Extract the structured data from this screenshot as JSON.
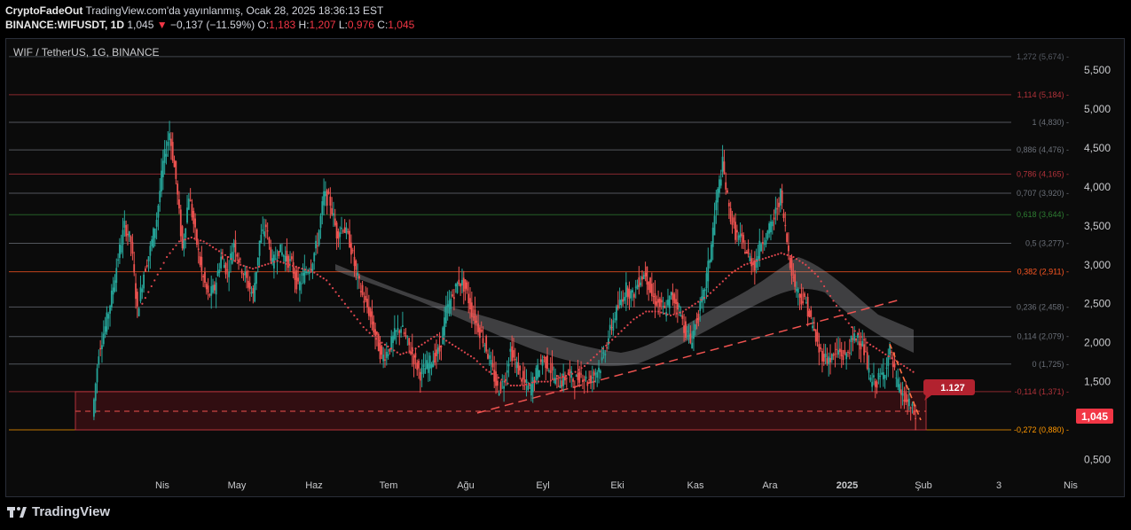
{
  "header": {
    "publisher_name": "CryptoFadeOut",
    "publisher_text": "TradingView.com'da yayınlanmış, Ocak 28, 2025 18:36:13 EST",
    "symbol": "BINANCE:WIFUSDT, 1D",
    "last": "1,045",
    "change": "−0,137 (−11.59%)",
    "o_label": "O:",
    "o_value": "1,183",
    "h_label": "H:",
    "h_value": "1,207",
    "l_label": "L:",
    "l_value": "0,976",
    "c_label": "C:",
    "c_value": "1,045"
  },
  "legend": {
    "title": "WIF / TetherUS, 1G, BINANCE"
  },
  "footer": {
    "brand": "TradingView"
  },
  "colors": {
    "up": "#26a69a",
    "down": "#ef5350",
    "background": "#0b0b0b",
    "fib_red": "#b2323a",
    "fib_green": "#2e7d32",
    "fib_orange": "#ff9800",
    "price_tag": "#f23645"
  },
  "chart_data": {
    "type": "candlestick",
    "y_axis_labels": [
      "5,500",
      "5,000",
      "4,500",
      "4,000",
      "3,500",
      "3,000",
      "2,500",
      "2,000",
      "1,500",
      "0,500"
    ],
    "ylim": [
      0.3,
      5.9
    ],
    "x_axis_labels": [
      "Nis",
      "May",
      "Haz",
      "Tem",
      "Ağu",
      "Eyl",
      "Eki",
      "Kas",
      "Ara",
      "2025",
      "Şub",
      "3",
      "Nis"
    ],
    "fib_levels": [
      {
        "label": "1,272 (5,674)",
        "value": 5.674,
        "color": "#555a63"
      },
      {
        "label": "1,114 (5,184)",
        "value": 5.184,
        "color": "#b2323a"
      },
      {
        "label": "1 (4,830)",
        "value": 4.83,
        "color": "#6b7079"
      },
      {
        "label": "0,886 (4,476)",
        "value": 4.476,
        "color": "#6b7079"
      },
      {
        "label": "0,786 (4,165)",
        "value": 4.165,
        "color": "#b2323a"
      },
      {
        "label": "0,707 (3,920)",
        "value": 3.92,
        "color": "#6b7079"
      },
      {
        "label": "0,618 (3,644)",
        "value": 3.644,
        "color": "#2e7d32"
      },
      {
        "label": "0,5 (3,277)",
        "value": 3.277,
        "color": "#6b7079"
      },
      {
        "label": "0,382 (2,911)",
        "value": 2.911,
        "color": "#ff5722"
      },
      {
        "label": "0,236 (2,458)",
        "value": 2.458,
        "color": "#6b7079"
      },
      {
        "label": "0,114 (2,079)",
        "value": 2.079,
        "color": "#6b7079"
      },
      {
        "label": "0 (1,725)",
        "value": 1.725,
        "color": "#6b7079"
      },
      {
        "label": "-0,114 (1,371)",
        "value": 1.371,
        "color": "#b2323a"
      },
      {
        "label": "-0,272 (0,880)",
        "value": 0.88,
        "color": "#ff9800"
      }
    ],
    "price_path": [
      1.05,
      1.9,
      2.2,
      2.6,
      3.1,
      3.5,
      3.3,
      2.4,
      2.9,
      3.2,
      3.6,
      4.3,
      4.7,
      4.1,
      3.2,
      3.9,
      3.4,
      2.9,
      2.6,
      2.7,
      3.1,
      2.9,
      3.3,
      3.0,
      2.8,
      2.6,
      3.3,
      3.5,
      3.0,
      3.2,
      3.1,
      3.0,
      2.7,
      2.9,
      3.0,
      3.3,
      3.9,
      3.8,
      3.4,
      3.5,
      3.3,
      2.9,
      2.6,
      2.4,
      2.1,
      1.8,
      1.9,
      2.1,
      2.2,
      2.0,
      1.8,
      1.6,
      1.7,
      1.8,
      1.9,
      2.4,
      2.6,
      2.8,
      2.7,
      2.4,
      2.2,
      2.0,
      1.7,
      1.4,
      1.5,
      1.9,
      1.7,
      1.5,
      1.4,
      1.6,
      1.8,
      1.7,
      1.5,
      1.5,
      1.6,
      1.5,
      1.6,
      1.5,
      1.6,
      1.7,
      2.0,
      2.3,
      2.5,
      2.7,
      2.6,
      2.8,
      2.9,
      2.6,
      2.5,
      2.4,
      2.6,
      2.5,
      2.2,
      2.0,
      2.3,
      2.6,
      3.1,
      3.8,
      4.3,
      3.7,
      3.4,
      3.3,
      3.1,
      3.0,
      3.3,
      3.4,
      3.6,
      3.9,
      3.3,
      2.8,
      2.6,
      2.5,
      2.2,
      1.9,
      1.8,
      1.8,
      1.9,
      1.8,
      2.0,
      2.1,
      1.9,
      1.5,
      1.5,
      1.6,
      1.9,
      1.5,
      1.3,
      1.2,
      1.05
    ],
    "sma_path": [
      null,
      null,
      null,
      null,
      2.5,
      2.8,
      3.1,
      3.3,
      3.35,
      3.3,
      3.2,
      3.1,
      3.0,
      2.95,
      3.0,
      3.05,
      3.0,
      2.95,
      2.9,
      2.8,
      2.6,
      2.4,
      2.2,
      2.05,
      1.95,
      1.85,
      1.9,
      2.0,
      2.1,
      2.0,
      1.9,
      1.8,
      1.65,
      1.55,
      1.45,
      1.45,
      1.5,
      1.5,
      1.55,
      1.6,
      1.7,
      1.85,
      2.0,
      2.15,
      2.3,
      2.4,
      2.4,
      2.35,
      2.4,
      2.5,
      2.6,
      2.75,
      2.9,
      3.0,
      3.05,
      3.1,
      3.15,
      3.1,
      3.0,
      2.85,
      2.6,
      2.35,
      2.15,
      2.0,
      1.9,
      1.8,
      1.7,
      1.6
    ],
    "box": {
      "top": 1.371,
      "bottom": 0.88,
      "dashed_mid": 1.12
    },
    "annotation": "1.127",
    "last_price_tag": "1,045"
  }
}
